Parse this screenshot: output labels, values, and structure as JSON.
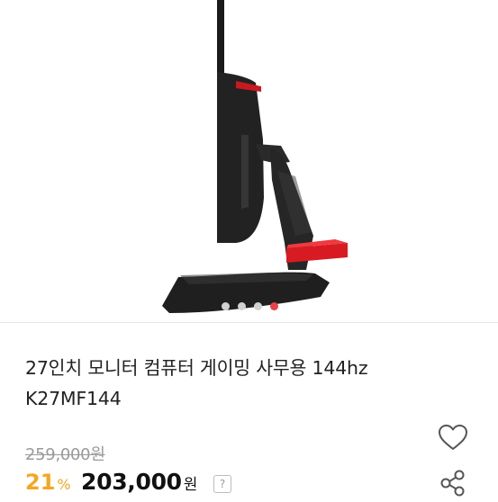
{
  "product": {
    "title_line1": "27인치 모니터 컴퓨터 게이밍 사무용 144hz",
    "title_line2": "K27MF144",
    "original_price": "259,000원",
    "discount_percent": "21",
    "discount_unit": "%",
    "sale_price": "203,000",
    "sale_price_unit": "원",
    "help_label": "?"
  },
  "carousel": {
    "total_images": 4,
    "active_index": 4
  },
  "colors": {
    "accent_red": "#e8434a",
    "discount_orange": "#f5a623",
    "stand_red": "#d81b22"
  },
  "icons": {
    "wishlist": "heart-outline-icon",
    "share": "share-icon"
  }
}
